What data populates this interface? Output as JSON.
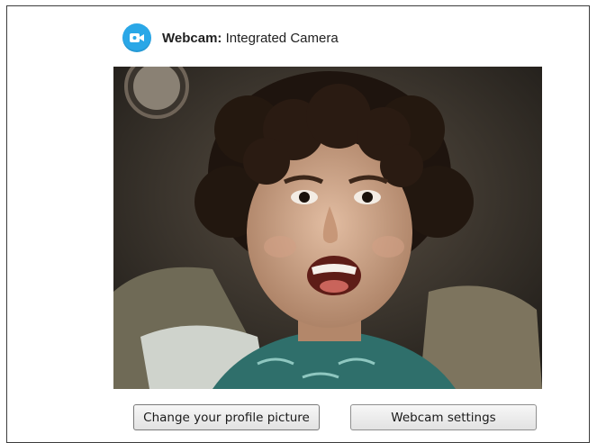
{
  "header": {
    "label": "Webcam:",
    "camera_name": "Integrated Camera",
    "icon": "webcam-icon"
  },
  "preview": {
    "description_icon": "webcam-preview"
  },
  "buttons": {
    "change_profile_picture": "Change your profile picture",
    "webcam_settings": "Webcam settings"
  },
  "colors": {
    "accent": "#2aa7e7"
  }
}
